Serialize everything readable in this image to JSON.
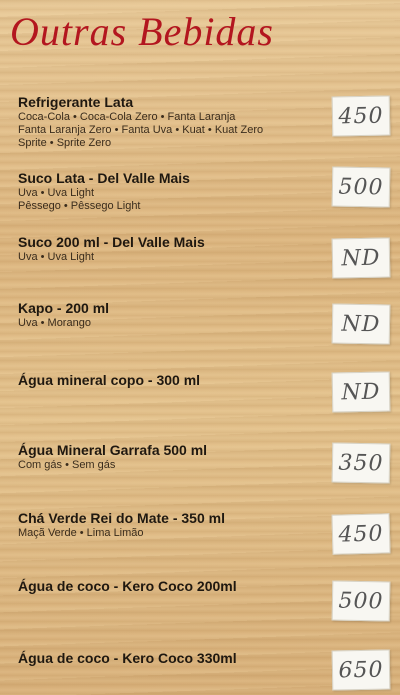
{
  "title": "Outras Bebidas",
  "items": [
    {
      "name": "Refrigerante Lata",
      "desc": [
        "Coca-Cola • Coca-Cola Zero • Fanta Laranja",
        "Fanta Laranja Zero • Fanta Uva • Kuat • Kuat Zero",
        "Sprite • Sprite Zero"
      ],
      "price": "450"
    },
    {
      "name": "Suco Lata - Del Valle Mais",
      "desc": [
        "Uva • Uva Light",
        "Pêssego  • Pêssego Light"
      ],
      "price": "500"
    },
    {
      "name": "Suco 200 ml - Del Valle Mais",
      "desc": [
        "Uva • Uva Light"
      ],
      "price": "ND"
    },
    {
      "name": "Kapo - 200 ml",
      "desc": [
        "Uva • Morango"
      ],
      "price": "ND"
    },
    {
      "name": "Água mineral copo - 300 ml",
      "desc": [],
      "price": "ND"
    },
    {
      "name": "Água Mineral Garrafa 500 ml",
      "desc": [
        "Com gás • Sem gás"
      ],
      "price": "350"
    },
    {
      "name": "Chá Verde Rei do Mate - 350 ml",
      "desc": [
        "Maçã Verde • Lima Limão"
      ],
      "price": "450"
    },
    {
      "name": "Água de coco - Kero Coco 200ml",
      "desc": [],
      "price": "500"
    },
    {
      "name": "Água de coco - Kero Coco 330ml",
      "desc": [],
      "price": "650"
    }
  ]
}
